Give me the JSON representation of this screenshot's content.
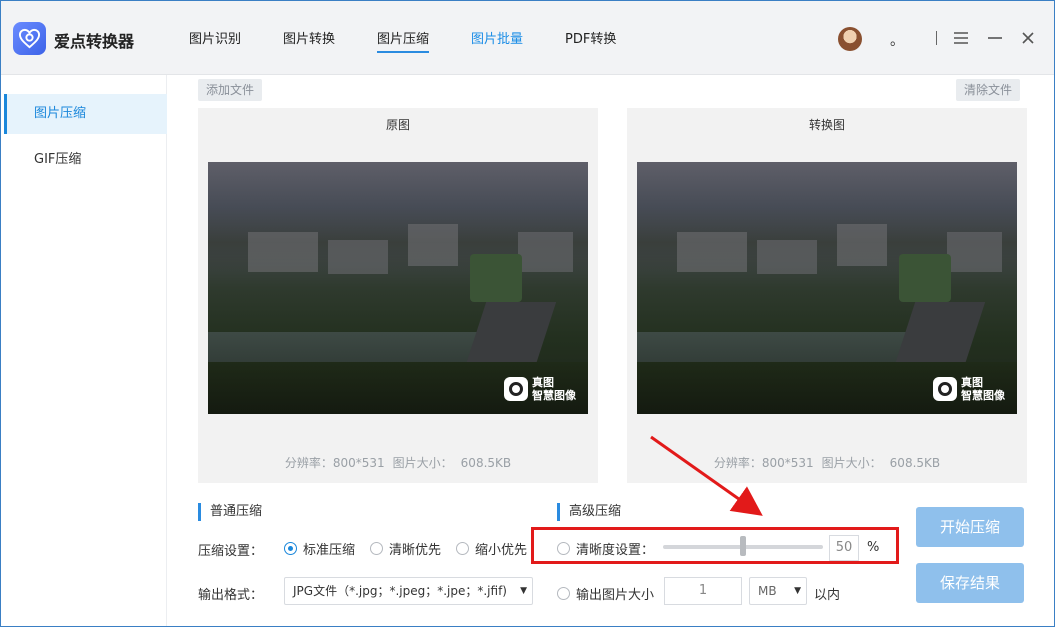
{
  "app": {
    "name": "爱点转换器"
  },
  "tabs": [
    {
      "label": "图片识别"
    },
    {
      "label": "图片转换"
    },
    {
      "label": "图片压缩"
    },
    {
      "label": "图片批量"
    },
    {
      "label": "PDF转换"
    }
  ],
  "window": {
    "dot": "。"
  },
  "sidebar": {
    "items": [
      {
        "label": "图片压缩"
      },
      {
        "label": "GIF压缩"
      }
    ]
  },
  "toolbar": {
    "add_file": "添加文件",
    "clear_file": "清除文件"
  },
  "original": {
    "title": "原图",
    "resolution_label": "分辨率：800*531",
    "size_label": "图片大小：",
    "size_value": "608.5KB",
    "watermark_line1": "真图",
    "watermark_line2": "智慧图像"
  },
  "converted": {
    "title": "转换图",
    "resolution_label": "分辨率：800*531",
    "size_label": "图片大小：",
    "size_value": "608.5KB",
    "watermark_line1": "真图",
    "watermark_line2": "智慧图像"
  },
  "normal": {
    "title": "普通压缩",
    "setting_label": "压缩设置：",
    "options": [
      "标准压缩",
      "清晰优先",
      "缩小优先"
    ],
    "selected_index": 0,
    "format_label": "输出格式：",
    "format_value": "JPG文件（*.jpg；*.jpeg；*.jpe；*.jfif)"
  },
  "advanced": {
    "title": "高级压缩",
    "clarity_label": "清晰度设置：",
    "clarity_value": "50",
    "clarity_unit": "%",
    "clarity_fraction": 0.5,
    "output_size_label": "输出图片大小",
    "output_size_value": "1",
    "output_size_unit": "MB",
    "output_size_suffix": "以内"
  },
  "actions": {
    "start": "开始压缩",
    "save": "保存结果"
  },
  "colors": {
    "accent": "#1a87db",
    "highlight": "#e21a1a",
    "button": "#8fc0ec"
  }
}
